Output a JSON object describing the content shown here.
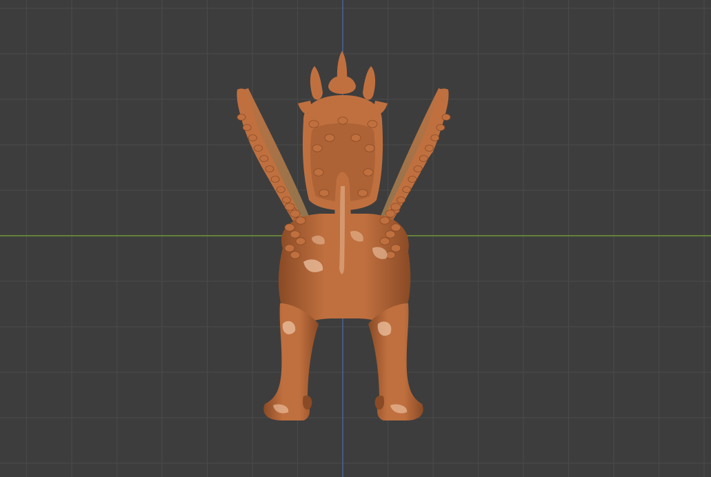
{
  "viewport": {
    "background": "#3d3d3d",
    "grid_color": "#4a4a4a",
    "x_axis_color": "#6f9a3a",
    "z_axis_color": "#4a6db0"
  },
  "model": {
    "name": "winged-lion-creature",
    "view": "back",
    "material_color": "#c0703f",
    "highlight_color": "#f0c8a8",
    "shadow_color": "#8a4a25",
    "wing_membrane_color": "#8a7550"
  }
}
